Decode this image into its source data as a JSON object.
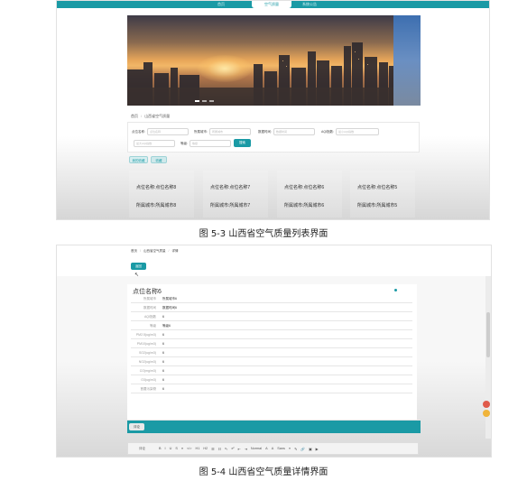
{
  "figure1": {
    "nav": {
      "items": [
        "首页",
        "空气质量",
        "系统公告"
      ]
    },
    "breadcrumb": [
      "首页",
      "山西省空气质量"
    ],
    "search": {
      "fields": [
        {
          "label": "点位名称:",
          "placeholder": "点位名称"
        },
        {
          "label": "所属城市:",
          "placeholder": "所属城市"
        },
        {
          "label": "数据时间:",
          "placeholder": "数据时间"
        },
        {
          "label": "AQI指数:",
          "placeholder": "最小AQI指数"
        },
        {
          "label": "",
          "placeholder": "最大AQI指数"
        },
        {
          "label": "等级:",
          "placeholder": "等级"
        }
      ],
      "button": "搜索"
    },
    "buttons": {
      "mine": "我的收藏",
      "collect": "收藏"
    },
    "cards": [
      {
        "name": "点位名称:点位名称8",
        "city": "所属城市:所属城市8"
      },
      {
        "name": "点位名称:点位名称7",
        "city": "所属城市:所属城市7"
      },
      {
        "name": "点位名称:点位名称6",
        "city": "所属城市:所属城市6"
      },
      {
        "name": "点位名称:点位名称5",
        "city": "所属城市:所属城市5"
      }
    ],
    "caption": "图 5-3 山西省空气质量列表界面"
  },
  "figure2": {
    "breadcrumb": [
      "首页",
      "山西省空气质量",
      "详情"
    ],
    "back_button": "返回",
    "title": "点位名称6",
    "rows": [
      {
        "key": "所属城市",
        "value": "所属城市6"
      },
      {
        "key": "数据时间",
        "value": "数据时间6"
      },
      {
        "key": "AQI指数",
        "value": "6"
      },
      {
        "key": "等级",
        "value": "等级6"
      },
      {
        "key": "PM2.5(ug/m3)",
        "value": "6"
      },
      {
        "key": "PM10(ug/m3)",
        "value": "6"
      },
      {
        "key": "SO2(ug/m3)",
        "value": "6"
      },
      {
        "key": "NO2(ug/m3)",
        "value": "6"
      },
      {
        "key": "CO(mg/m3)",
        "value": "6"
      },
      {
        "key": "O3(ug/m3)",
        "value": "6"
      },
      {
        "key": "首要污染物",
        "value": "6"
      }
    ],
    "comment_tag": "评论",
    "editor": {
      "label": "评论",
      "tools": [
        "B",
        "I",
        "U",
        "S",
        "❝",
        "</>",
        "H1",
        "H2",
        "☰",
        "☷",
        "x₂",
        "x²",
        "⇤",
        "⇥",
        "Normal",
        "A",
        "A",
        "Sans",
        "≡",
        "✎",
        "🔗",
        "▣",
        "▶"
      ]
    },
    "caption": "图 5-4 山西省空气质量详情界面"
  }
}
